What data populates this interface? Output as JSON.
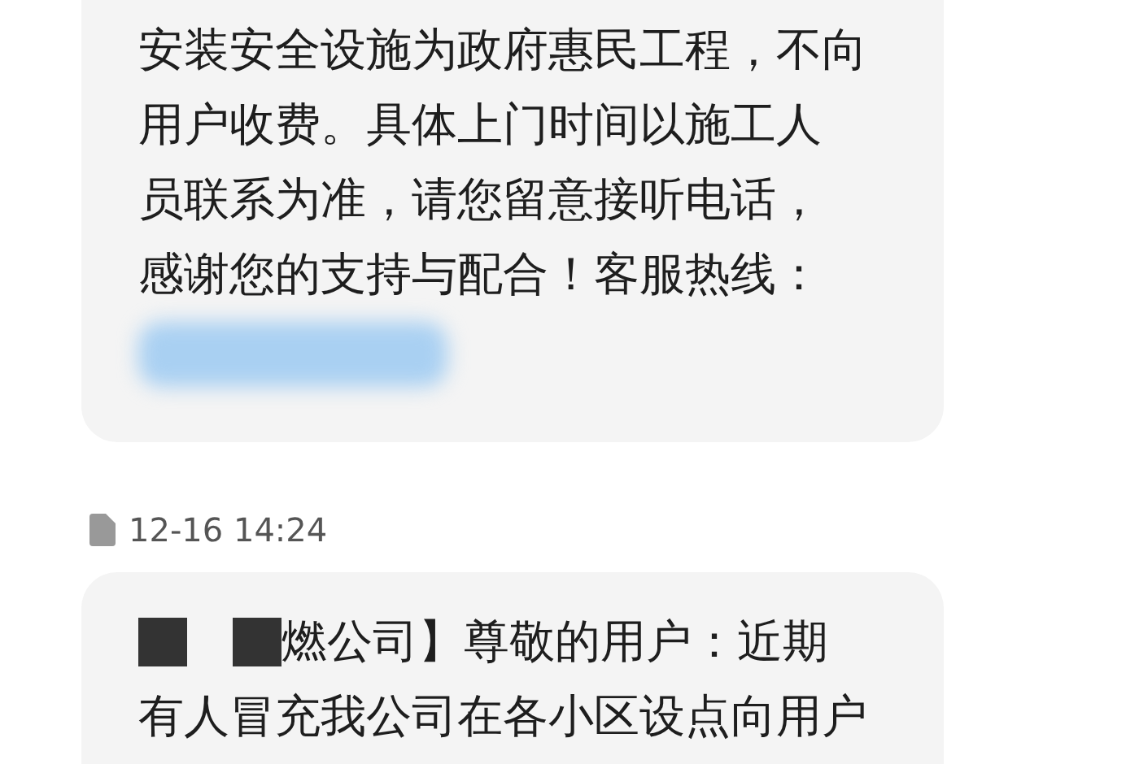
{
  "messages": [
    {
      "lines": [
        "安装安全设施为政府惠民工程，不向",
        "用户收费。具体上门时间以施工人",
        "员联系为准，请您留意接听电话，",
        "感谢您的支持与配合！客服热线："
      ],
      "redacted_tail": true
    },
    {
      "timestamp": "12-16 14:24",
      "lead_redacted": true,
      "lines": [
        "燃公司】尊敬的用户：近期",
        "有人冒充我公司在各小区设点向用户"
      ]
    }
  ]
}
